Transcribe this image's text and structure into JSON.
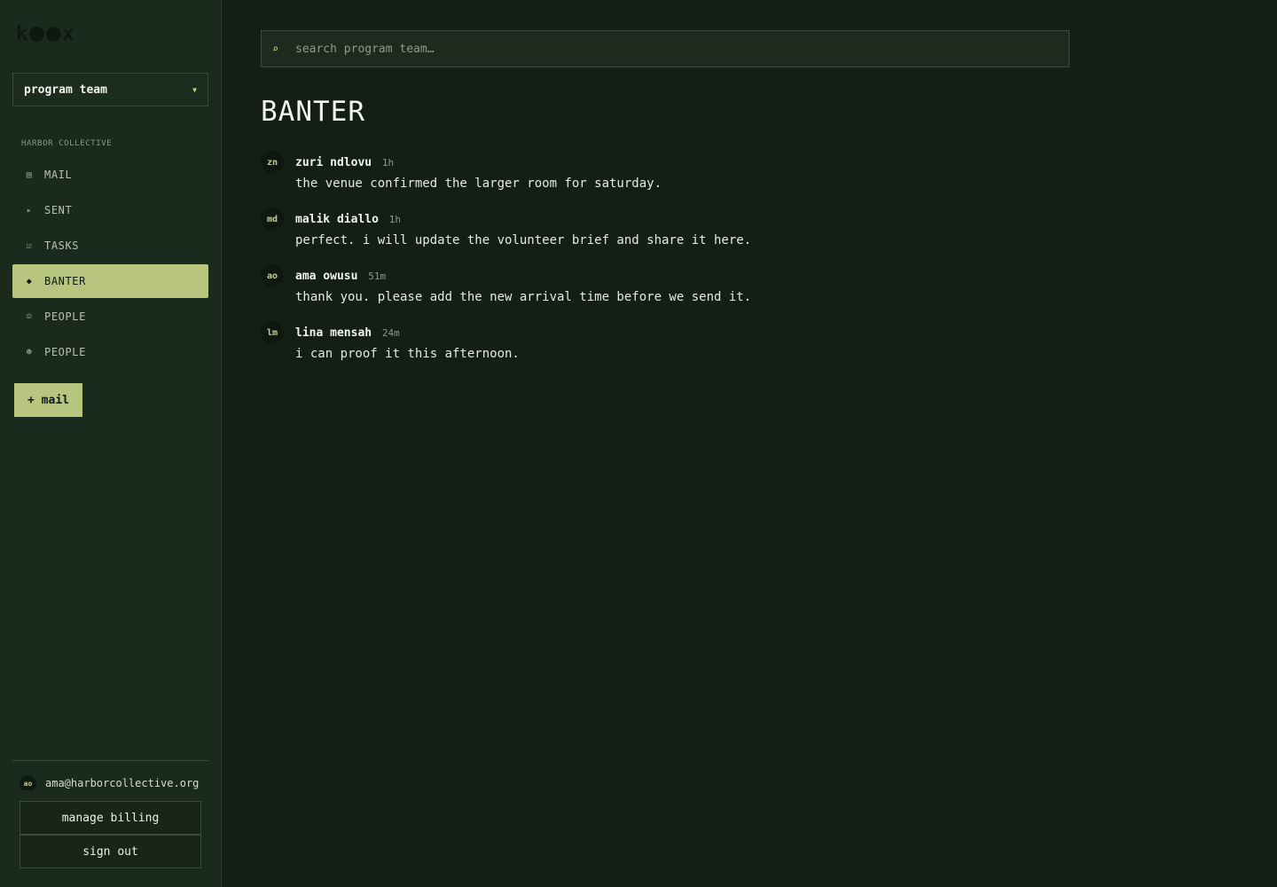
{
  "logo": {
    "left": "k",
    "right": "x"
  },
  "team_select": {
    "value": "program team"
  },
  "sidebar": {
    "org_label": "HARBOR COLLECTIVE",
    "items": [
      {
        "icon": "mail-icon",
        "glyph": "▤",
        "label": "MAIL",
        "active": false
      },
      {
        "icon": "send-icon",
        "glyph": "▸",
        "label": "SENT",
        "active": false
      },
      {
        "icon": "tasks-icon",
        "glyph": "☑",
        "label": "TASKS",
        "active": false
      },
      {
        "icon": "banter-icon",
        "glyph": "◆",
        "label": "BANTER",
        "active": true
      },
      {
        "icon": "person-icon",
        "glyph": "☺",
        "label": "PEOPLE",
        "active": false
      },
      {
        "icon": "people-icon",
        "glyph": "☻",
        "label": "PEOPLE",
        "active": false
      }
    ],
    "compose_label": "+ mail"
  },
  "account": {
    "initials": "ao",
    "email": "ama@harborcollective.org",
    "billing_label": "manage billing",
    "signout_label": "sign out"
  },
  "search": {
    "placeholder": "search program team…"
  },
  "page_title": "BANTER",
  "messages": [
    {
      "initials": "zn",
      "author": "zuri ndlovu",
      "time": "1h",
      "text": "the venue confirmed the larger room for saturday."
    },
    {
      "initials": "md",
      "author": "malik diallo",
      "time": "1h",
      "text": "perfect. i will update the volunteer brief and share it here."
    },
    {
      "initials": "ao",
      "author": "ama owusu",
      "time": "51m",
      "text": "thank you. please add the new arrival time before we send it."
    },
    {
      "initials": "lm",
      "author": "lina mensah",
      "time": "24m",
      "text": "i can proof it this afternoon."
    }
  ],
  "colors": {
    "accent": "#b7c57f",
    "background": "#131f15",
    "sidebar": "#1a2a1c"
  }
}
